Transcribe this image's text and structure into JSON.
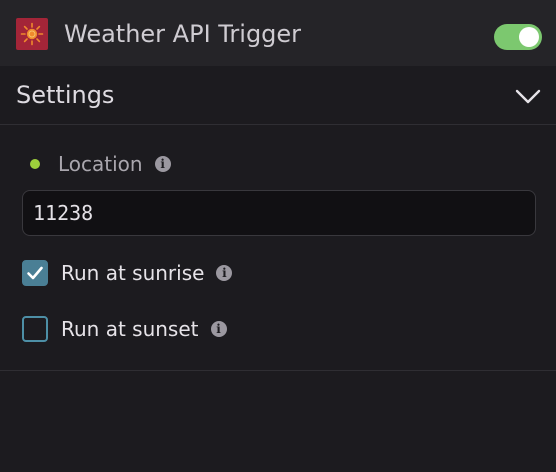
{
  "header": {
    "title": "Weather API Trigger",
    "icon": "sun-icon",
    "enabled": true,
    "toggle_color": "#7cc86f"
  },
  "settings": {
    "title": "Settings",
    "expanded": true
  },
  "location": {
    "label": "Location",
    "value": "11238",
    "status_color": "#9ed03c"
  },
  "options": [
    {
      "label": "Run at sunrise",
      "checked": true
    },
    {
      "label": "Run at sunset",
      "checked": false
    }
  ],
  "info_glyph": "i"
}
